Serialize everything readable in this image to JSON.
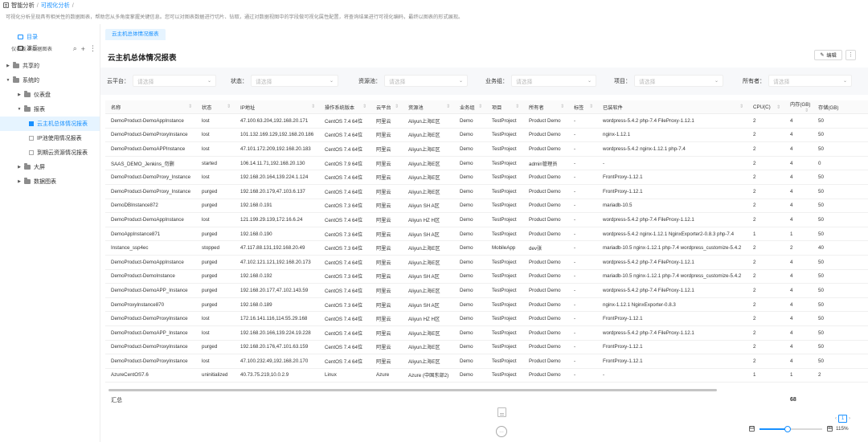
{
  "breadcrumb": {
    "items": [
      "智能分析",
      "可视化分析"
    ],
    "separator": "/"
  },
  "description": "可视化分析呈现具有相关性的数据图表，帮助您从多角度掌握关键信息。您可以对图表数据进行切片、钻取，通过对数据视图中的字段做可视化属性配置，将查询结果进行可视化编码，最终以图表的形式展现。",
  "sidebar": {
    "top_items": [
      {
        "label": "目录",
        "icon": "folder-icon",
        "active": true
      },
      {
        "label": "演示",
        "icon": "monitor-icon",
        "active": false
      }
    ],
    "section_title": "仪表板 & 数据图表",
    "tree": [
      {
        "label": "共享的",
        "level": 0,
        "type": "folder",
        "expanded": false
      },
      {
        "label": "系统的",
        "level": 0,
        "type": "folder",
        "expanded": true
      },
      {
        "label": "仪表盘",
        "level": 1,
        "type": "folder",
        "expanded": false
      },
      {
        "label": "报表",
        "level": 1,
        "type": "folder",
        "expanded": true
      },
      {
        "label": "云主机总体情况报表",
        "level": 2,
        "type": "doc",
        "selected": true
      },
      {
        "label": "IP池使用情况报表",
        "level": 2,
        "type": "doc",
        "selected": false
      },
      {
        "label": "到期云资源情况报表",
        "level": 2,
        "type": "doc",
        "selected": false
      },
      {
        "label": "大屏",
        "level": 1,
        "type": "folder",
        "expanded": false
      },
      {
        "label": "数据图表",
        "level": 1,
        "type": "folder",
        "expanded": false
      }
    ]
  },
  "tab": {
    "label": "云主机总体情况报表"
  },
  "report": {
    "title": "云主机总体情况报表",
    "edit_label": "编辑",
    "more_label": "⋮"
  },
  "filters": [
    {
      "label": "云平台：",
      "placeholder": "请选择"
    },
    {
      "label": "状态：",
      "placeholder": "请选择"
    },
    {
      "label": "资源池：",
      "placeholder": "请选择"
    },
    {
      "label": "业务组：",
      "placeholder": "请选择"
    },
    {
      "label": "项目：",
      "placeholder": "请选择"
    },
    {
      "label": "所有者：",
      "placeholder": "请选择"
    }
  ],
  "table": {
    "columns": [
      "名称",
      "状态",
      "IP地址",
      "操作系统版本",
      "云平台",
      "资源池",
      "业务组",
      "项目",
      "所有者",
      "标签",
      "已装软件",
      "CPU(C)",
      "内存(GB)",
      "存储(GB)"
    ],
    "sortable": [
      true,
      true,
      true,
      true,
      true,
      true,
      true,
      true,
      true,
      true,
      true,
      true,
      true,
      true
    ],
    "rows": [
      [
        "DemoProduct-DemoAppInstance",
        "lost",
        "47.100.63.204,192.168.20.171",
        "CentOS 7.4 64位",
        "阿里云",
        "Aliyun上海E区",
        "Demo",
        "TestProject",
        "Product Demo",
        "-",
        "wordpress-5.4.2 php-7.4 FileProxy-1.12.1",
        "2",
        "4",
        "50"
      ],
      [
        "DemoProduct-DemoProxyInstance",
        "lost",
        "101.132.169.129,192.168.20.186",
        "CentOS 7.4 64位",
        "阿里云",
        "Aliyun上海E区",
        "Demo",
        "TestProject",
        "Product Demo",
        "-",
        "nginx-1.12.1",
        "2",
        "4",
        "50"
      ],
      [
        "DemoProduct-DemoAPPInstance",
        "lost",
        "47.101.172.209,192.168.20.183",
        "CentOS 7.4 64位",
        "阿里云",
        "Aliyun上海E区",
        "Demo",
        "TestProject",
        "Product Demo",
        "-",
        "wordpress-5.4.2 nginx-1.12.1 php-7.4",
        "2",
        "4",
        "50"
      ],
      [
        "SAAS_DEMO_Jenkins_勿删",
        "started",
        "106.14.11.71,192.168.20.130",
        "CentOS 7.9 64位",
        "阿里云",
        "Aliyun上海E区",
        "Demo",
        "TestProject",
        "admin管理员",
        "-",
        "-",
        "2",
        "4",
        "0"
      ],
      [
        "DemoProduct-DemoProxy_Instance",
        "lost",
        "192.168.20.164,139.224.1.124",
        "CentOS 7.4 64位",
        "阿里云",
        "Aliyun上海E区",
        "Demo",
        "TestProject",
        "Product Demo",
        "-",
        "FrontProxy-1.12.1",
        "2",
        "4",
        "50"
      ],
      [
        "DemoProduct-DemoProxy_Instance",
        "purged",
        "192.168.20.179,47.103.6.137",
        "CentOS 7.4 64位",
        "阿里云",
        "Aliyun上海E区",
        "Demo",
        "TestProject",
        "Product Demo",
        "-",
        "FrontProxy-1.12.1",
        "2",
        "4",
        "50"
      ],
      [
        "DemoDBInstance872",
        "purged",
        "192.168.0.191",
        "CentOS 7.3 64位",
        "阿里云",
        "Aliyun SH A区",
        "Demo",
        "TestProject",
        "Product Demo",
        "-",
        "mariadb-10.5",
        "2",
        "4",
        "50"
      ],
      [
        "DemoProduct-DemoAppInstance",
        "lost",
        "121.199.29.139,172.16.6.24",
        "CentOS 7.4 64位",
        "阿里云",
        "Aliyun HZ H区",
        "Demo",
        "TestProject",
        "Product Demo",
        "-",
        "wordpress-5.4.2 php-7.4 FileProxy-1.12.1",
        "2",
        "4",
        "50"
      ],
      [
        "DemoAppInstance871",
        "purged",
        "192.168.0.190",
        "CentOS 7.3 64位",
        "阿里云",
        "Aliyun SH A区",
        "Demo",
        "TestProject",
        "Product Demo",
        "-",
        "wordpress-5.4.2 nginx-1.12.1 NginxExporter2-0.8.3 php-7.4",
        "1",
        "1",
        "50"
      ],
      [
        "Instance_ssp4ec",
        "stopped",
        "47.117.88.131,192.168.20.49",
        "CentOS 7.3 64位",
        "阿里云",
        "Aliyun上海E区",
        "Demo",
        "MobileApp",
        "dev张",
        "-",
        "mariadb-10.5 nginx-1.12.1 php-7.4 wordpress_customize-5.4.2",
        "2",
        "2",
        "40"
      ],
      [
        "DemoProduct-DemoAppInstance",
        "purged",
        "47.102.121.121,192.168.20.173",
        "CentOS 7.4 64位",
        "阿里云",
        "Aliyun上海E区",
        "Demo",
        "TestProject",
        "Product Demo",
        "-",
        "wordpress-5.4.2 php-7.4 FileProxy-1.12.1",
        "2",
        "4",
        "50"
      ],
      [
        "DemoProduct-DemoInstance",
        "purged",
        "192.168.0.192",
        "CentOS 7.3 64位",
        "阿里云",
        "Aliyun SH A区",
        "Demo",
        "TestProject",
        "Product Demo",
        "-",
        "mariadb-10.5 nginx-1.12.1 php-7.4 wordpress_customize-5.4.2",
        "2",
        "4",
        "50"
      ],
      [
        "DemoProduct-DemoAPP_Instance",
        "purged",
        "192.168.20.177,47.102.143.59",
        "CentOS 7.4 64位",
        "阿里云",
        "Aliyun上海E区",
        "Demo",
        "TestProject",
        "Product Demo",
        "-",
        "wordpress-5.4.2 php-7.4 FileProxy-1.12.1",
        "2",
        "4",
        "50"
      ],
      [
        "DemoProxyInstance870",
        "purged",
        "192.168.0.189",
        "CentOS 7.3 64位",
        "阿里云",
        "Aliyun SH A区",
        "Demo",
        "TestProject",
        "Product Demo",
        "-",
        "nginx-1.12.1 NginxExporter-0.8.3",
        "2",
        "4",
        "50"
      ],
      [
        "DemoProduct-DemoProxyInstance",
        "lost",
        "172.16.141.116,114.55.29.168",
        "CentOS 7.4 64位",
        "阿里云",
        "Aliyun HZ H区",
        "Demo",
        "TestProject",
        "Product Demo",
        "-",
        "FrontProxy-1.12.1",
        "2",
        "4",
        "50"
      ],
      [
        "DemoProduct-DemoAPP_Instance",
        "lost",
        "192.168.20.166,139.224.19.228",
        "CentOS 7.4 64位",
        "阿里云",
        "Aliyun上海E区",
        "Demo",
        "TestProject",
        "Product Demo",
        "-",
        "wordpress-5.4.2 php-7.4 FileProxy-1.12.1",
        "2",
        "4",
        "50"
      ],
      [
        "DemoProduct-DemoProxyInstance",
        "purged",
        "192.168.20.176,47.101.63.159",
        "CentOS 7.4 64位",
        "阿里云",
        "Aliyun上海E区",
        "Demo",
        "TestProject",
        "Product Demo",
        "-",
        "FrontProxy-1.12.1",
        "2",
        "4",
        "50"
      ],
      [
        "DemoProduct-DemoProxyInstance",
        "lost",
        "47.100.232.49,192.168.20.170",
        "CentOS 7.4 64位",
        "阿里云",
        "Aliyun上海E区",
        "Demo",
        "TestProject",
        "Product Demo",
        "-",
        "FrontProxy-1.12.1",
        "2",
        "4",
        "50"
      ],
      [
        "AzureCentOS7.6",
        "uninitialized",
        "40.73.75.219,10.0.2.9",
        "Linux",
        "Azure",
        "Azure (中国东部2)",
        "Demo",
        "TestProject",
        "Product Demo",
        "-",
        "-",
        "1",
        "1",
        "2"
      ]
    ],
    "summary_label": "汇总",
    "summary_value": "68"
  },
  "pager": {
    "current": "1"
  },
  "zoom": {
    "label": "115%",
    "minus": "⊟",
    "plus": "⊞",
    "level": 0.45
  },
  "colors": {
    "accent": "#1890ff",
    "tab_bg": "#e6f4ff",
    "filter_bg": "#f7f8fa"
  }
}
